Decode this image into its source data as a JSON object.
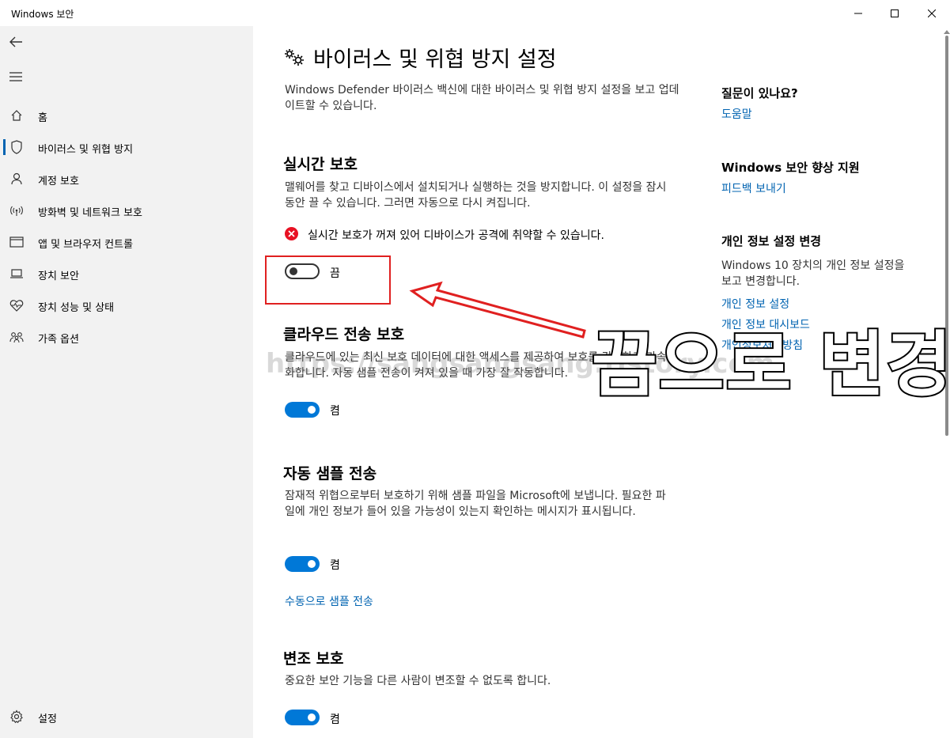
{
  "window": {
    "title": "Windows 보안"
  },
  "sidebar": {
    "items": [
      {
        "label": "홈",
        "icon": "home-icon"
      },
      {
        "label": "바이러스 및 위협 방지",
        "icon": "shield-icon",
        "active": true
      },
      {
        "label": "계정 보호",
        "icon": "person-icon"
      },
      {
        "label": "방화벽 및 네트워크 보호",
        "icon": "wifi-icon"
      },
      {
        "label": "앱 및 브라우저 컨트롤",
        "icon": "app-window-icon"
      },
      {
        "label": "장치 보안",
        "icon": "laptop-icon"
      },
      {
        "label": "장치 성능 및 상태",
        "icon": "heart-pulse-icon"
      },
      {
        "label": "가족 옵션",
        "icon": "family-icon"
      }
    ],
    "settings_label": "설정"
  },
  "main": {
    "title": "바이러스 및 위협 방지 설정",
    "intro": "Windows Defender 바이러스 백신에 대한 바이러스 및 위협 방지 설정을 보고 업데이트할 수 있습니다.",
    "realtime": {
      "title": "실시간 보호",
      "desc": "맬웨어를 찾고 디바이스에서 설치되거나 실행하는 것을 방지합니다. 이 설정을 잠시 동안 끌 수 있습니다. 그러면 자동으로 다시 켜집니다.",
      "warning": "실시간 보호가 꺼져 있어 디바이스가 공격에 취약할 수 있습니다.",
      "toggle_label": "끔",
      "on": false
    },
    "cloud": {
      "title": "클라우드 전송 보호",
      "desc": "클라우드에 있는 최신 보호 데이터에 대한 액세스를 제공하여 보호를 강화하고 가속화합니다. 자동 샘플 전송이 켜져 있을 때 가장 잘 작동합니다.",
      "toggle_label": "켬",
      "on": true
    },
    "sample": {
      "title": "자동 샘플 전송",
      "desc": "잠재적 위협으로부터 보호하기 위해 샘플 파일을 Microsoft에 보냅니다. 필요한 파일에 개인 정보가 들어 있을 가능성이 있는지 확인하는 메시지가 표시됩니다.",
      "toggle_label": "켬",
      "on": true,
      "manual_link": "수동으로 샘플 전송"
    },
    "tamper": {
      "title": "변조 보호",
      "desc": "중요한 보안 기능을 다른 사람이 변조할 수 없도록 합니다.",
      "toggle_label": "켬",
      "on": true
    }
  },
  "aside": {
    "question_title": "질문이 있나요?",
    "help_link": "도움말",
    "improve_title": "Windows 보안 향상 지원",
    "feedback_link": "피드백 보내기",
    "privacy_title": "개인 정보 설정 변경",
    "privacy_desc": "Windows 10 장치의 개인 정보 설정을 보고 변경합니다.",
    "privacy_link": "개인 정보 설정",
    "privacy_dashboard_link": "개인 정보 대시보드",
    "privacy_statement_link": "개인정보처리방침"
  },
  "annotation": {
    "callout": "끔으로 변경",
    "watermark": "https://sangsangsang.tistory.com",
    "color": "#e02020"
  },
  "colors": {
    "accent": "#0078d7",
    "link": "#0063b1",
    "error": "#e81123",
    "sidebar_bg": "#f2f2f2"
  }
}
